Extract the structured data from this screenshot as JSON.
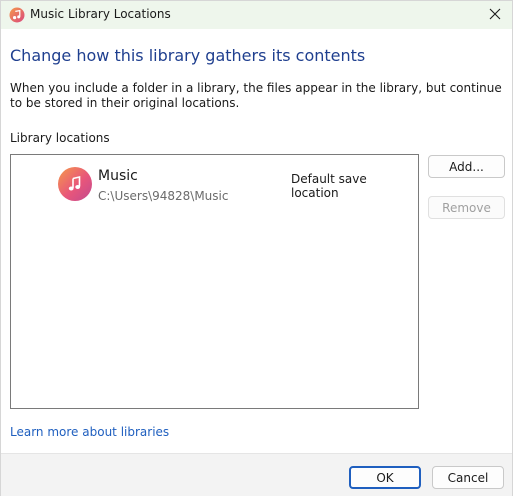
{
  "window": {
    "title": "Music Library Locations",
    "close_icon": "close-icon"
  },
  "main": {
    "heading": "Change how this library gathers its contents",
    "description": "When you include a folder in a library, the files appear in the library, but continue to be stored in their original locations.",
    "locations_label": "Library locations",
    "locations": [
      {
        "name": "Music",
        "path": "C:\\Users\\94828\\Music",
        "badge": "Default save location",
        "icon": "music-note-icon"
      }
    ],
    "add_label": "Add...",
    "remove_label": "Remove",
    "learn_more": "Learn more about libraries"
  },
  "footer": {
    "ok_label": "OK",
    "cancel_label": "Cancel"
  },
  "colors": {
    "accent": "#1f5fbf",
    "heading": "#1f3f8f",
    "titlebar": "#eef6ec"
  }
}
